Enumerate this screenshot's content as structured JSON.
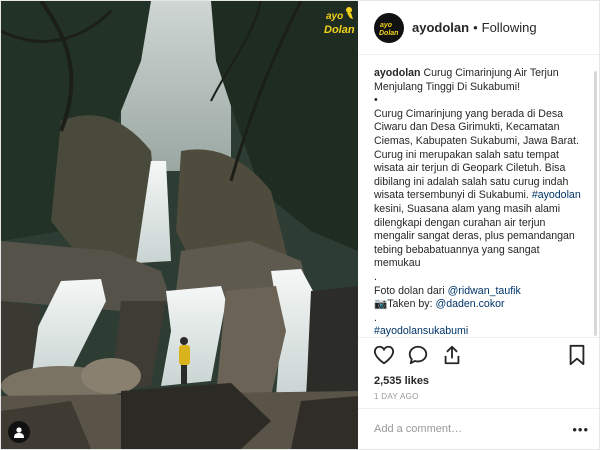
{
  "post": {
    "username": "ayodolan",
    "follow_separator": "•",
    "follow_status": "Following",
    "brand_logo_text": [
      "ayo",
      "Dolan"
    ],
    "caption": {
      "username": "ayodolan",
      "title": " Curug Cimarinjung Air Terjun Menjulang Tinggi Di Sukabumi!",
      "bullet": "•",
      "body": "Curug Cimarinjung yang berada di Desa Ciwaru dan Desa Girimukti, Kecamatan Ciemas, Kabupaten Sukabumi, Jawa Barat. Curug ini merupakan salah satu tempat wisata air terjun di Geopark Ciletuh. Bisa dibilang ini adalah salah satu curug indah wisata tersembunyi di Sukabumi.",
      "body_tag": "#ayodolan",
      "body_rest": " kesini, Suasana alam yang masih alami dilengkapi dengan curahan air terjun mengalir sangat deras, plus pemandangan tebing bebabatuannya yang sangat memukau",
      "sep_dot": ".",
      "photo_credit_prefix": "Foto dolan dari ",
      "photo_credit_handle": "@ridwan_taufik",
      "taken_by_prefix": "📷Taken by: ",
      "taken_by_handle": "@daden.cokor",
      "hashtag": "#ayodolansukabumi"
    },
    "likes": "2,535 likes",
    "time_ago": "1 DAY AGO",
    "comment_placeholder": "Add a comment…",
    "more_options": "•••"
  },
  "icons": {
    "like": "heart-icon",
    "comment": "comment-icon",
    "share": "share-icon",
    "save": "bookmark-icon",
    "tag": "person-tag-icon"
  },
  "colors": {
    "link": "#003569",
    "text": "#262626",
    "muted": "#999999",
    "logo_yellow": "#f2d21b"
  }
}
